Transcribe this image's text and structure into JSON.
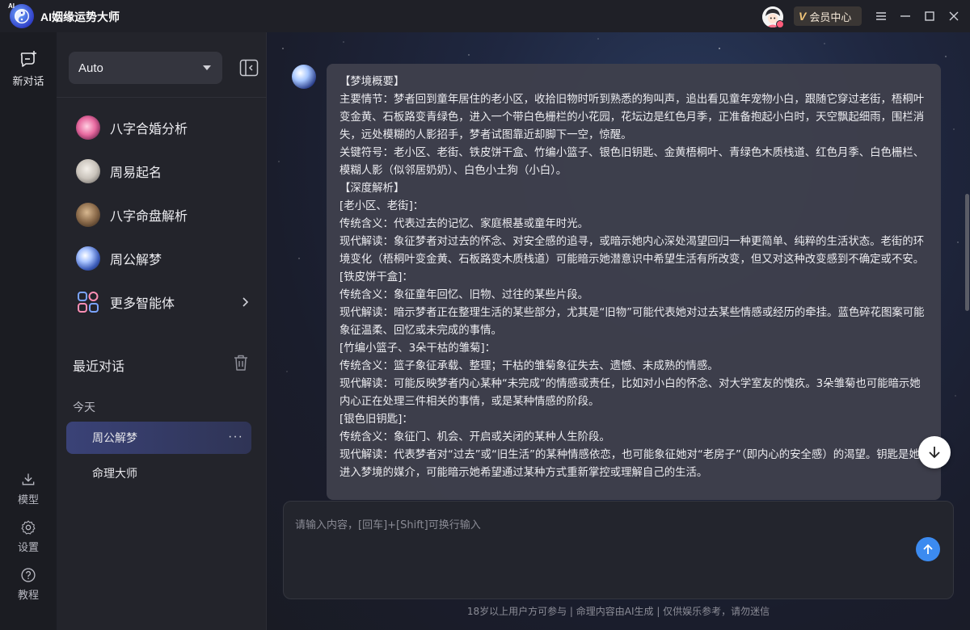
{
  "app": {
    "title": "AI姻缘运势大师",
    "logo_badge": "AI"
  },
  "titlebar": {
    "member_label": "会员中心",
    "member_mark": "V"
  },
  "rail": {
    "new_chat": "新对话",
    "model": "模型",
    "settings": "设置",
    "tutorial": "教程"
  },
  "sidebar": {
    "model_selected": "Auto",
    "agents": [
      {
        "label": "八字合婚分析",
        "icon": "heart-orb-icon",
        "color": "#e86aa0"
      },
      {
        "label": "周易起名",
        "icon": "bagua-orb-icon",
        "color": "#c9c3bb"
      },
      {
        "label": "八字命盘解析",
        "icon": "compass-orb-icon",
        "color": "#8a6a4a"
      },
      {
        "label": "周公解梦",
        "icon": "moon-orb-icon",
        "color": "#3b5bb8"
      },
      {
        "label": "更多智能体",
        "icon": "grid-apps-icon",
        "color": "#7aa4ff"
      }
    ],
    "recent_title": "最近对话",
    "group_today": "今天",
    "conversations": [
      {
        "label": "周公解梦",
        "active": true
      },
      {
        "label": "命理大师",
        "active": false
      }
    ],
    "more_glyph": "···"
  },
  "message": {
    "lines": [
      "【梦境概要】",
      "主要情节：梦者回到童年居住的老小区，收拾旧物时听到熟悉的狗叫声，追出看见童年宠物小白，跟随它穿过老街，梧桐叶变金黄、石板路变青绿色，进入一个带白色栅栏的小花园，花坛边是红色月季，正准备抱起小白时，天空飘起细雨，围栏消失，远处模糊的人影招手，梦者试图靠近却脚下一空，惊醒。",
      "关键符号：老小区、老街、铁皮饼干盒、竹编小篮子、银色旧钥匙、金黄梧桐叶、青绿色木质栈道、红色月季、白色栅栏、模糊人影（似邻居奶奶）、白色小土狗（小白）。",
      "【深度解析】",
      "[老小区、老街]：",
      "传统含义：代表过去的记忆、家庭根基或童年时光。",
      "现代解读：象征梦者对过去的怀念、对安全感的追寻，或暗示她内心深处渴望回归一种更简单、纯粹的生活状态。老街的环境变化（梧桐叶变金黄、石板路变木质栈道）可能暗示她潜意识中希望生活有所改变，但又对这种改变感到不确定或不安。",
      "[铁皮饼干盒]：",
      "传统含义：象征童年回忆、旧物、过往的某些片段。",
      "现代解读：暗示梦者正在整理生活的某些部分，尤其是“旧物”可能代表她对过去某些情感或经历的牵挂。蓝色碎花图案可能象征温柔、回忆或未完成的事情。",
      "[竹编小篮子、3朵干枯的雏菊]：",
      "传统含义：篮子象征承载、整理；干枯的雏菊象征失去、遗憾、未成熟的情感。",
      "现代解读：可能反映梦者内心某种“未完成”的情感或责任，比如对小白的怀念、对大学室友的愧疚。3朵雏菊也可能暗示她内心正在处理三件相关的事情，或是某种情感的阶段。",
      "[银色旧钥匙]：",
      "传统含义：象征门、机会、开启或关闭的某种人生阶段。",
      "现代解读：代表梦者对“过去”或“旧生活”的某种情感依恋，也可能象征她对“老房子”（即内心的安全感）的渴望。钥匙是她进入梦境的媒介，可能暗示她希望通过某种方式重新掌控或理解自己的生活。"
    ]
  },
  "composer": {
    "placeholder": "请输入内容，[回车]+[Shift]可换行输入"
  },
  "footer": {
    "disclaimer": "18岁以上用户方可参与 | 命理内容由AI生成 | 仅供娱乐参考，请勿迷信"
  },
  "colors": {
    "accent": "#3c8bf0",
    "member_gold": "#f2c679",
    "active_conv": "#3a4277"
  }
}
